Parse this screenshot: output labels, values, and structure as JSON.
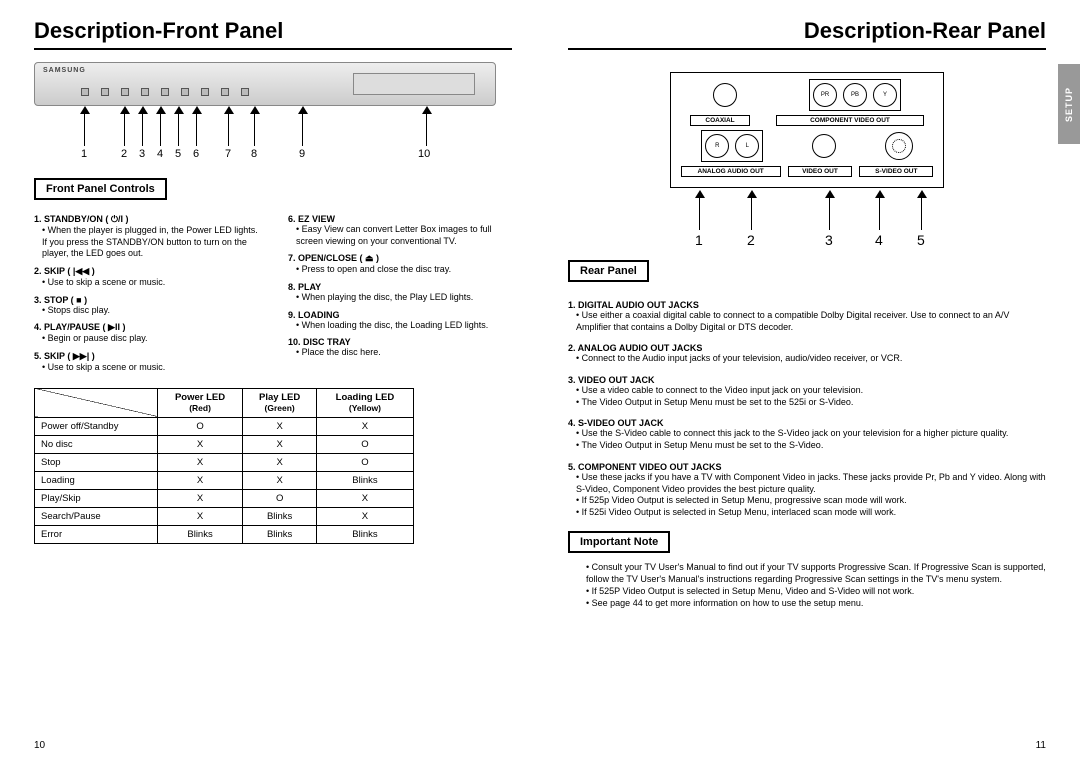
{
  "left": {
    "title": "Description-Front Panel",
    "brand": "SAMSUNG",
    "nums": [
      "1",
      "2",
      "3",
      "4",
      "5",
      "6",
      "7",
      "8",
      "9",
      "10"
    ],
    "section": "Front Panel Controls",
    "items_col1": [
      {
        "t": "1. STANDBY/ON ( ⏻/I )",
        "d": "When the player is plugged in, the Power LED lights. If you press the STANDBY/ON button to turn on the player, the LED goes out."
      },
      {
        "t": "2. SKIP ( |◀◀ )",
        "d": "Use to skip a scene or music."
      },
      {
        "t": "3. STOP ( ■ )",
        "d": "Stops disc play."
      },
      {
        "t": "4. PLAY/PAUSE ( ▶II )",
        "d": "Begin or pause disc play."
      },
      {
        "t": "5. SKIP ( ▶▶| )",
        "d": "Use to skip a scene or music."
      }
    ],
    "items_col2": [
      {
        "t": "6. EZ VIEW",
        "d": "Easy View can convert Letter Box images to full screen viewing on your conventional TV."
      },
      {
        "t": "7. OPEN/CLOSE ( ⏏ )",
        "d": "Press to open and close the disc tray."
      },
      {
        "t": "8. PLAY",
        "d": "When playing the disc, the Play LED lights."
      },
      {
        "t": "9. LOADING",
        "d": "When loading the disc, the Loading LED lights."
      },
      {
        "t": "10. DISC TRAY",
        "d": "Place the disc here."
      }
    ],
    "table": {
      "headers": [
        {
          "h": "Power LED",
          "s": "(Red)"
        },
        {
          "h": "Play LED",
          "s": "(Green)"
        },
        {
          "h": "Loading LED",
          "s": "(Yellow)"
        }
      ],
      "rows": [
        {
          "label": "Power off/Standby",
          "c": [
            "O",
            "X",
            "X"
          ]
        },
        {
          "label": "No disc",
          "c": [
            "X",
            "X",
            "O"
          ]
        },
        {
          "label": "Stop",
          "c": [
            "X",
            "X",
            "O"
          ]
        },
        {
          "label": "Loading",
          "c": [
            "X",
            "X",
            "Blinks"
          ]
        },
        {
          "label": "Play/Skip",
          "c": [
            "X",
            "O",
            "X"
          ]
        },
        {
          "label": "Search/Pause",
          "c": [
            "X",
            "Blinks",
            "X"
          ]
        },
        {
          "label": "Error",
          "c": [
            "Blinks",
            "Blinks",
            "Blinks"
          ]
        }
      ]
    },
    "pagenum": "10"
  },
  "right": {
    "title": "Description-Rear Panel",
    "sidetab": "SETUP",
    "rp_labels": {
      "coaxial": "COAXIAL",
      "component": "COMPONENT VIDEO OUT",
      "analog": "ANALOG AUDIO OUT",
      "video": "VIDEO OUT",
      "svideo": "S-VIDEO OUT",
      "r": "R",
      "l": "L",
      "pr": "PR",
      "pb": "PB",
      "y": "Y"
    },
    "nums": [
      "1",
      "2",
      "3",
      "4",
      "5"
    ],
    "section": "Rear Panel",
    "items": [
      {
        "t": "1. DIGITAL AUDIO OUT JACKS",
        "d": [
          "Use either a coaxial digital cable to connect to a compatible Dolby Digital receiver. Use to connect to an A/V Amplifier that contains a Dolby Digital or DTS decoder."
        ]
      },
      {
        "t": "2. ANALOG AUDIO OUT JACKS",
        "d": [
          "Connect to the Audio input jacks of your television, audio/video receiver, or VCR."
        ]
      },
      {
        "t": "3. VIDEO OUT JACK",
        "d": [
          "Use a video cable to connect to the Video input jack on your television.",
          "The Video Output in Setup Menu must be set to the 525i or S-Video."
        ]
      },
      {
        "t": "4. S-VIDEO OUT JACK",
        "d": [
          "Use the S-Video cable to connect this jack to the S-Video jack on your television for a higher picture quality.",
          "The Video Output in Setup Menu must be set to the S-Video."
        ]
      },
      {
        "t": "5. COMPONENT VIDEO OUT JACKS",
        "d": [
          "Use these jacks if you have a TV with Component Video in jacks. These jacks provide Pr, Pb and Y video. Along with S-Video, Component Video provides the best picture quality.",
          "If 525p Video Output is selected in Setup Menu, progressive scan mode will work.",
          "If 525i Video Output is selected in Setup Menu, interlaced scan mode will work."
        ]
      }
    ],
    "note_section": "Important Note",
    "notes": [
      "Consult your TV User's Manual to find out if your TV supports Progressive Scan. If Progressive Scan is supported, follow the TV User's Manual's instructions regarding Progressive Scan settings in the TV's menu system.",
      "If 525P Video Output is selected in Setup Menu, Video and S-Video will not work.",
      "See page 44 to get more information on how to use the setup menu."
    ],
    "pagenum": "11"
  }
}
